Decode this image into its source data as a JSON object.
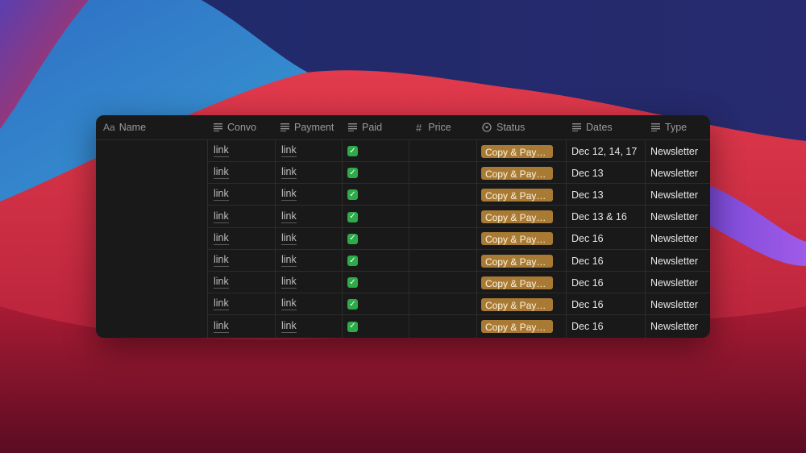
{
  "columns": {
    "name": "Name",
    "convo": "Convo",
    "payment": "Payment",
    "paid": "Paid",
    "price": "Price",
    "status": "Status",
    "dates": "Dates",
    "type": "Type"
  },
  "icons": {
    "name": "Aa",
    "price": "#"
  },
  "colors": {
    "status_tag": "#a87a34",
    "check": "#2eaa4a",
    "panel": "#191919"
  },
  "rows": [
    {
      "convo": "link",
      "payment": "link",
      "paid": "✓",
      "status": "Copy & Payme...",
      "dates": "Dec 12, 14, 17",
      "type": "Newsletter"
    },
    {
      "convo": "link",
      "payment": "link",
      "paid": "✓",
      "status": "Copy & Payme...",
      "dates": "Dec 13",
      "type": "Newsletter"
    },
    {
      "convo": "link",
      "payment": "link",
      "paid": "✓",
      "status": "Copy & Payme...",
      "dates": "Dec 13",
      "type": "Newsletter"
    },
    {
      "convo": "link",
      "payment": "link",
      "paid": "✓",
      "status": "Copy & Payme...",
      "dates": "Dec 13 & 16",
      "type": "Newsletter"
    },
    {
      "convo": "link",
      "payment": "link",
      "paid": "✓",
      "status": "Copy & Payme...",
      "dates": "Dec 16",
      "type": "Newsletter"
    },
    {
      "convo": "link",
      "payment": "link",
      "paid": "✓",
      "status": "Copy & Payme...",
      "dates": "Dec 16",
      "type": "Newsletter"
    },
    {
      "convo": "link",
      "payment": "link",
      "paid": "✓",
      "status": "Copy & Payme...",
      "dates": "Dec 16",
      "type": "Newsletter"
    },
    {
      "convo": "link",
      "payment": "link",
      "paid": "✓",
      "status": "Copy & Payme...",
      "dates": "Dec 16",
      "type": "Newsletter"
    },
    {
      "convo": "link",
      "payment": "link",
      "paid": "✓",
      "status": "Copy & Payme...",
      "dates": "Dec 16",
      "type": "Newsletter"
    }
  ]
}
